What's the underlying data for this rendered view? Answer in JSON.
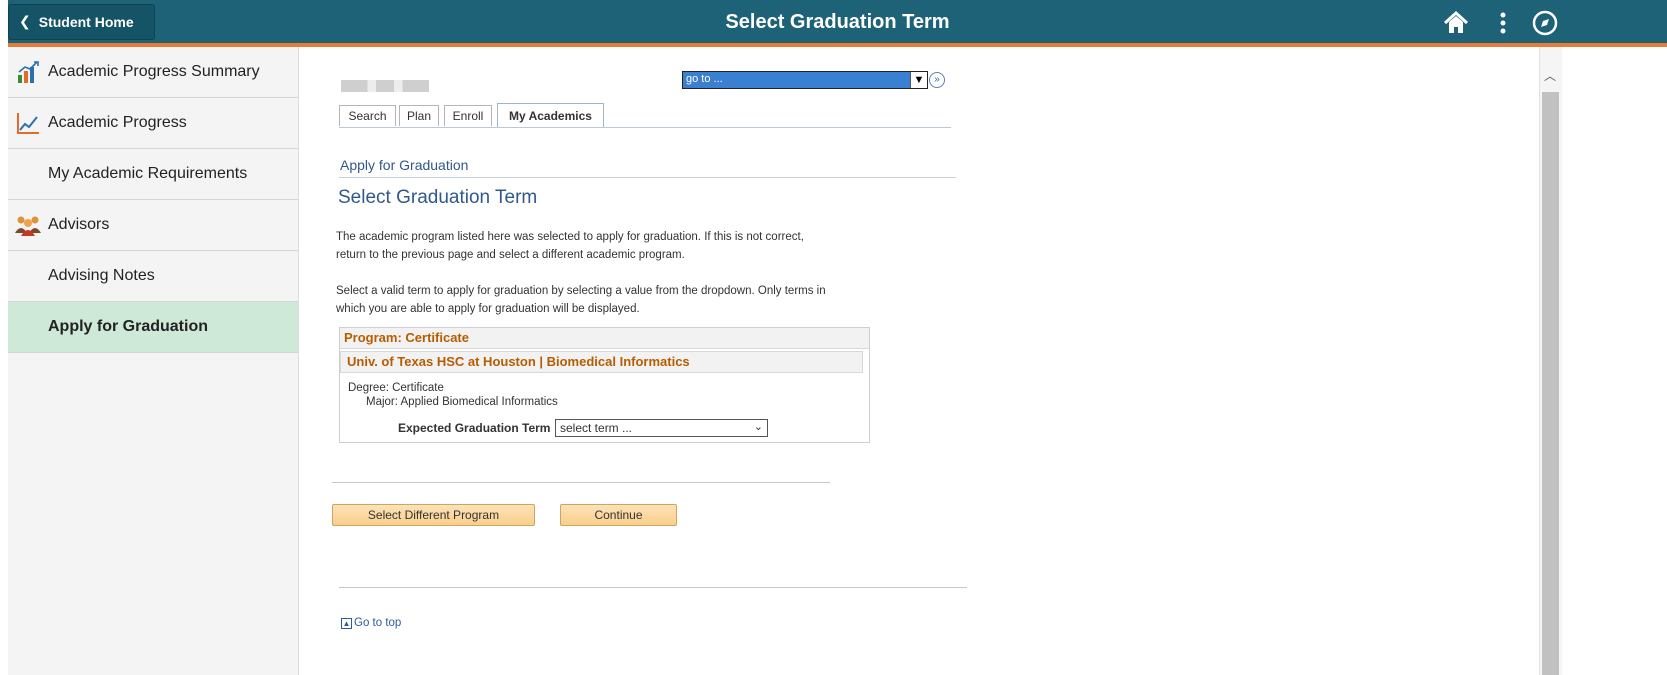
{
  "header": {
    "back_label": "Student Home",
    "title": "Select Graduation Term",
    "icons": [
      "home-icon",
      "more-vertical-icon",
      "compass-icon"
    ]
  },
  "sidebar": {
    "items": [
      {
        "label": "Academic Progress Summary",
        "icon": "bar-chart-icon"
      },
      {
        "label": "Academic Progress",
        "icon": "line-chart-icon"
      },
      {
        "label": "My Academic Requirements"
      },
      {
        "label": "Advisors",
        "icon": "people-icon"
      },
      {
        "label": "Advising Notes"
      },
      {
        "label": "Apply for Graduation",
        "active": true
      }
    ]
  },
  "main": {
    "goto_value": "go to ...",
    "tabs": [
      "Search",
      "Plan",
      "Enroll",
      "My Academics"
    ],
    "breadcrumb": "Apply for Graduation",
    "heading": "Select Graduation Term",
    "para1_line1": "The academic program listed here was selected to apply for graduation. If this is not correct,",
    "para1_line2": "return to the previous page and select a different academic program.",
    "para2_line1": "Select a valid term to apply for graduation by selecting a value from the dropdown. Only terms in",
    "para2_line2": "which you are able to apply for graduation will be displayed.",
    "program": {
      "header": "Program: Certificate",
      "institution": "Univ. of Texas HSC at Houston | Biomedical Informatics",
      "degree": "Degree: Certificate",
      "major": "Major: Applied Biomedical Informatics",
      "term_label": "Expected Graduation Term",
      "term_value": "select term ..."
    },
    "buttons": {
      "select_program": "Select Different Program",
      "continue": "Continue"
    },
    "go_to_top": "Go to top"
  },
  "colors": {
    "header_bg": "#1d6277",
    "header_accent": "#e77c3a",
    "active_sidebar": "#cfe9d8",
    "link_blue": "#30588c",
    "program_orange": "#b85c00"
  }
}
